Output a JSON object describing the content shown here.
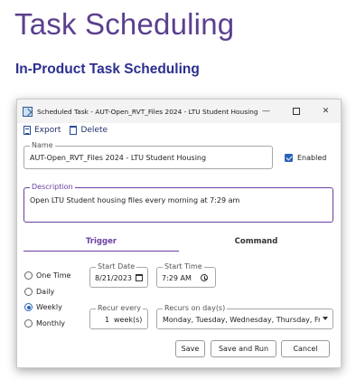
{
  "slide": {
    "title": "Task Scheduling",
    "subtitle": "In-Product Task Scheduling"
  },
  "window": {
    "title": "Scheduled Task - AUT-Open_RVT_Files 2024 - LTU Student Housing",
    "controls": {
      "minimize": "—",
      "close": "✕"
    }
  },
  "toolbar": {
    "export_label": "Export",
    "delete_label": "Delete"
  },
  "name": {
    "label": "Name",
    "value": "AUT-Open_RVT_Files 2024 - LTU Student Housing"
  },
  "enabled": {
    "label": "Enabled",
    "checked": true
  },
  "description": {
    "label": "Description",
    "value": "Open LTU Student housing files every morning at 7:29 am"
  },
  "tabs": {
    "trigger": "Trigger",
    "command": "Command",
    "active": "Trigger"
  },
  "frequency": {
    "options": [
      "One Time",
      "Daily",
      "Weekly",
      "Monthly"
    ],
    "selected": "Weekly"
  },
  "start_date": {
    "label": "Start Date",
    "value": "8/21/2023"
  },
  "start_time": {
    "label": "Start Time",
    "value": "7:29 AM"
  },
  "recur_every": {
    "label": "Recur every",
    "value": "1",
    "unit": "week(s)"
  },
  "recurs_on": {
    "label": "Recurs on day(s)",
    "value": "Monday, Tuesday, Wednesday, Thursday, Fr"
  },
  "buttons": {
    "save": "Save",
    "save_and_run": "Save and Run",
    "cancel": "Cancel"
  },
  "colors": {
    "title": "#5b3f8f",
    "subtitle": "#2b2f8f",
    "accent": "#6a3fa0",
    "checkbox": "#2a63b8"
  }
}
